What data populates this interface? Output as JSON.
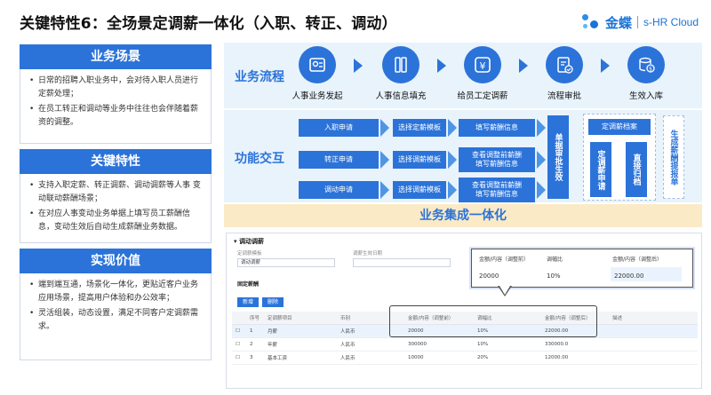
{
  "title": "关键特性6：全场景定调薪一体化（入职、转正、调动）",
  "logo": {
    "cn": "金蝶",
    "en": "s-HR Cloud"
  },
  "left": {
    "s1": {
      "title": "业务场景",
      "items": [
        "日常的招聘入职业务中，会对待入职人员进行定薪处理；",
        "在员工转正和调动等业务中往往也会伴随着薪资的调整。"
      ]
    },
    "s2": {
      "title": "关键特性",
      "items": [
        "支持入职定薪、转正调薪、调动调薪等人事 变动联动薪酬场景；",
        "在对应人事变动业务单据上填写员工薪酬信息，变动生效后自动生成薪酬业务数据。"
      ]
    },
    "s3": {
      "title": "实现价值",
      "items": [
        "端到端互通，场景化一体化，更贴近客户业务应用场景，提高用户体验和办公效率；",
        "灵活组装，动态设置，满足不同客户定调薪需求。"
      ]
    }
  },
  "flow": {
    "label": "业务流程",
    "steps": [
      "人事业务发起",
      "人事信息填充",
      "给员工定调薪",
      "流程审批",
      "生效入库"
    ]
  },
  "interaction": {
    "label": "功能交互",
    "rows": [
      {
        "a": "入职申请",
        "b": "选择定薪模板",
        "c": "填写薪酬信息"
      },
      {
        "a": "转正申请",
        "b": "选择调薪模板",
        "c": "查看调整前薪酬\n填写薪酬信息"
      },
      {
        "a": "调动申请",
        "b": "选择调薪模板",
        "c": "查看调整前薪酬\n填写薪酬信息"
      }
    ],
    "approve": "单据审批生效",
    "archive_top": "定调薪档案",
    "archive_l": "定调薪申请",
    "archive_r": "直接归档",
    "gen": "生成薪酬提报单"
  },
  "band": "业务集成一体化",
  "form": {
    "header": "▾ 调动调薪",
    "f1_label": "定调薪模板",
    "f1_value": "调动调薪",
    "f2_label": "调薪生效日期",
    "sub": "固定薪酬",
    "btn_add": "新增",
    "btn_del": "删除",
    "columns": [
      "",
      "序号",
      "定调薪项目",
      "币别",
      "金额/内容（调整前）",
      "调幅比",
      "金额/内容（调整后）",
      "描述"
    ],
    "rows": [
      [
        "",
        "1",
        "月薪",
        "人民币",
        "20000",
        "10%",
        "22000.00",
        ""
      ],
      [
        "",
        "2",
        "年薪",
        "人民币",
        "300000",
        "10%",
        "330000.0",
        ""
      ],
      [
        "",
        "3",
        "基本工资",
        "人民币",
        "10000",
        "20%",
        "12000.00",
        ""
      ]
    ]
  },
  "popup": {
    "h1": "金额/内容（调整前）",
    "h2": "调幅比",
    "h3": "金额/内容（调整后）",
    "v1": "20000",
    "v2": "10%",
    "v3": "22000.00"
  }
}
